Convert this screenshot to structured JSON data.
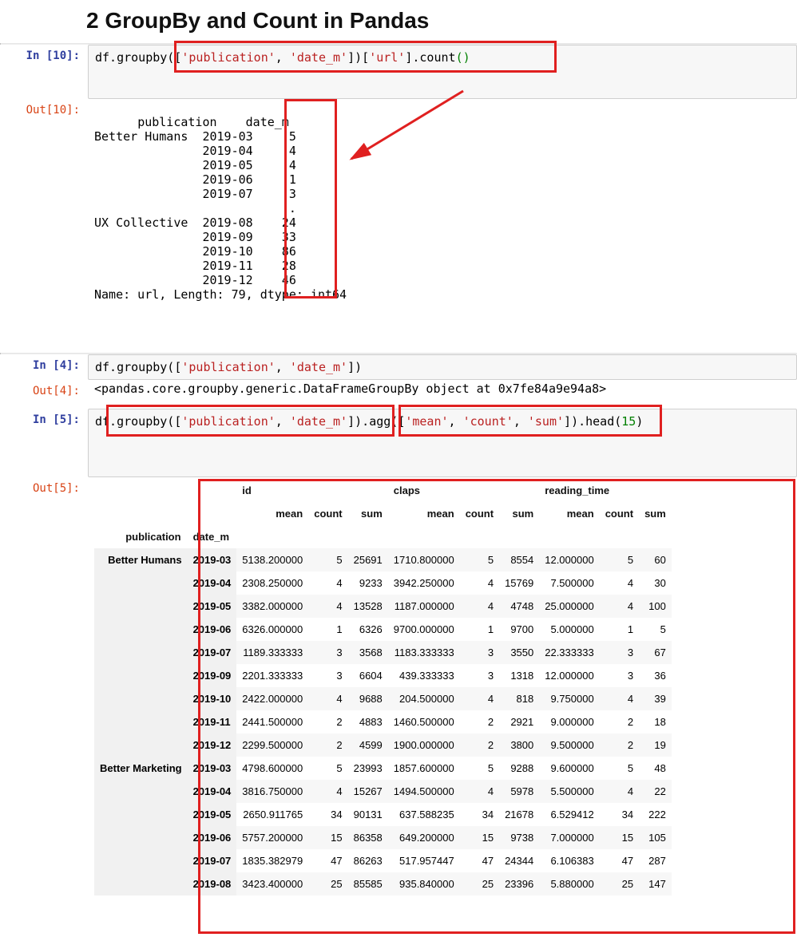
{
  "heading": "2  GroupBy and Count in Pandas",
  "cell10": {
    "in_prompt": "In [10]:",
    "out_prompt": "Out[10]:",
    "code_prefix": "df.groupby(",
    "code_list_open": "[",
    "code_s1": "'publication'",
    "code_comma1": ", ",
    "code_s2": "'date_m'",
    "code_list_close": "]",
    "code_after1": ")[",
    "code_s3": "'url'",
    "code_after2": "].count",
    "code_parens": "()",
    "output": "publication    date_m \nBetter Humans  2019-03     5\n               2019-04     4\n               2019-05     4\n               2019-06     1\n               2019-07     3\n                          ..\nUX Collective  2019-08    24\n               2019-09    33\n               2019-10    86\n               2019-11    28\n               2019-12    46\nName: url, Length: 79, dtype: int64"
  },
  "cell4": {
    "in_prompt": "In [4]:",
    "out_prompt": "Out[4]:",
    "code_prefix": "df.groupby(",
    "code_list_open": "[",
    "code_s1": "'publication'",
    "code_comma1": ", ",
    "code_s2": "'date_m'",
    "code_list_close": "]",
    "code_after": ")",
    "output": "<pandas.core.groupby.generic.DataFrameGroupBy object at 0x7fe84a9e94a8>"
  },
  "cell5": {
    "in_prompt": "In [5]:",
    "out_prompt": "Out[5]:",
    "p1": "df.",
    "p_groupby1": "groupby(",
    "lo": "[",
    "s1": "'publication'",
    "c1": ", ",
    "s2": "'date_m'",
    "lc": "]",
    "gb_close": ")",
    "dot": ".",
    "p_agg": "agg(",
    "lo2": "[",
    "s3": "'mean'",
    "c2": ", ",
    "s4": "'count'",
    "c3": ", ",
    "s5": "'sum'",
    "lc2": "]",
    "agg_close": ")",
    "dot2": ".",
    "p_head": "head(",
    "n15": "15",
    "head_close": ")"
  },
  "table": {
    "top_headers": [
      "id",
      "claps",
      "reading_time"
    ],
    "sub_headers": [
      "mean",
      "count",
      "sum"
    ],
    "index_names": [
      "publication",
      "date_m"
    ],
    "rows": [
      {
        "pub": "Better Humans",
        "date": "2019-03",
        "vals": [
          "5138.200000",
          "5",
          "25691",
          "1710.800000",
          "5",
          "8554",
          "12.000000",
          "5",
          "60"
        ]
      },
      {
        "pub": "",
        "date": "2019-04",
        "vals": [
          "2308.250000",
          "4",
          "9233",
          "3942.250000",
          "4",
          "15769",
          "7.500000",
          "4",
          "30"
        ]
      },
      {
        "pub": "",
        "date": "2019-05",
        "vals": [
          "3382.000000",
          "4",
          "13528",
          "1187.000000",
          "4",
          "4748",
          "25.000000",
          "4",
          "100"
        ]
      },
      {
        "pub": "",
        "date": "2019-06",
        "vals": [
          "6326.000000",
          "1",
          "6326",
          "9700.000000",
          "1",
          "9700",
          "5.000000",
          "1",
          "5"
        ]
      },
      {
        "pub": "",
        "date": "2019-07",
        "vals": [
          "1189.333333",
          "3",
          "3568",
          "1183.333333",
          "3",
          "3550",
          "22.333333",
          "3",
          "67"
        ]
      },
      {
        "pub": "",
        "date": "2019-09",
        "vals": [
          "2201.333333",
          "3",
          "6604",
          "439.333333",
          "3",
          "1318",
          "12.000000",
          "3",
          "36"
        ]
      },
      {
        "pub": "",
        "date": "2019-10",
        "vals": [
          "2422.000000",
          "4",
          "9688",
          "204.500000",
          "4",
          "818",
          "9.750000",
          "4",
          "39"
        ]
      },
      {
        "pub": "",
        "date": "2019-11",
        "vals": [
          "2441.500000",
          "2",
          "4883",
          "1460.500000",
          "2",
          "2921",
          "9.000000",
          "2",
          "18"
        ]
      },
      {
        "pub": "",
        "date": "2019-12",
        "vals": [
          "2299.500000",
          "2",
          "4599",
          "1900.000000",
          "2",
          "3800",
          "9.500000",
          "2",
          "19"
        ]
      },
      {
        "pub": "Better Marketing",
        "date": "2019-03",
        "vals": [
          "4798.600000",
          "5",
          "23993",
          "1857.600000",
          "5",
          "9288",
          "9.600000",
          "5",
          "48"
        ]
      },
      {
        "pub": "",
        "date": "2019-04",
        "vals": [
          "3816.750000",
          "4",
          "15267",
          "1494.500000",
          "4",
          "5978",
          "5.500000",
          "4",
          "22"
        ]
      },
      {
        "pub": "",
        "date": "2019-05",
        "vals": [
          "2650.911765",
          "34",
          "90131",
          "637.588235",
          "34",
          "21678",
          "6.529412",
          "34",
          "222"
        ]
      },
      {
        "pub": "",
        "date": "2019-06",
        "vals": [
          "5757.200000",
          "15",
          "86358",
          "649.200000",
          "15",
          "9738",
          "7.000000",
          "15",
          "105"
        ]
      },
      {
        "pub": "",
        "date": "2019-07",
        "vals": [
          "1835.382979",
          "47",
          "86263",
          "517.957447",
          "47",
          "24344",
          "6.106383",
          "47",
          "287"
        ]
      },
      {
        "pub": "",
        "date": "2019-08",
        "vals": [
          "3423.400000",
          "25",
          "85585",
          "935.840000",
          "25",
          "23396",
          "5.880000",
          "25",
          "147"
        ]
      }
    ]
  }
}
